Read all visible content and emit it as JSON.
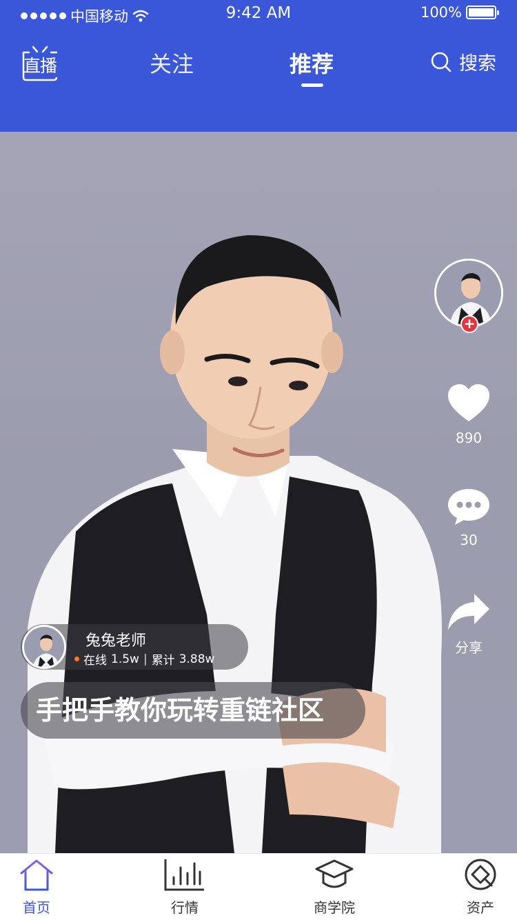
{
  "status_bar": {
    "carrier": "中国移动",
    "time": "9:42 AM",
    "battery": "100%"
  },
  "header": {
    "logo_text": "直播",
    "tabs": [
      {
        "label": "关注",
        "active": false
      },
      {
        "label": "推荐",
        "active": true
      }
    ],
    "search_label": "搜索"
  },
  "side_actions": {
    "likes": "890",
    "comments": "30",
    "share_label": "分享"
  },
  "anchor": {
    "name": "兔兔老师",
    "online_label": "在线",
    "online_count": "1.5w",
    "total_label": "累计",
    "total_count": "3.88w"
  },
  "stream_title": "手把手教你玩转重链社区",
  "tabbar": {
    "items": [
      {
        "label": "首页",
        "icon": "home-icon",
        "active": true
      },
      {
        "label": "行情",
        "icon": "bar-chart-icon",
        "active": false
      },
      {
        "label": "商学院",
        "icon": "graduation-cap-icon",
        "active": false
      },
      {
        "label": "资产",
        "icon": "assets-icon",
        "active": false
      }
    ]
  },
  "colors": {
    "brand": "#3b57d9",
    "like_heart": "#ffffff",
    "follow_plus": "#e8343f",
    "online_dot": "#ff7a2f"
  }
}
